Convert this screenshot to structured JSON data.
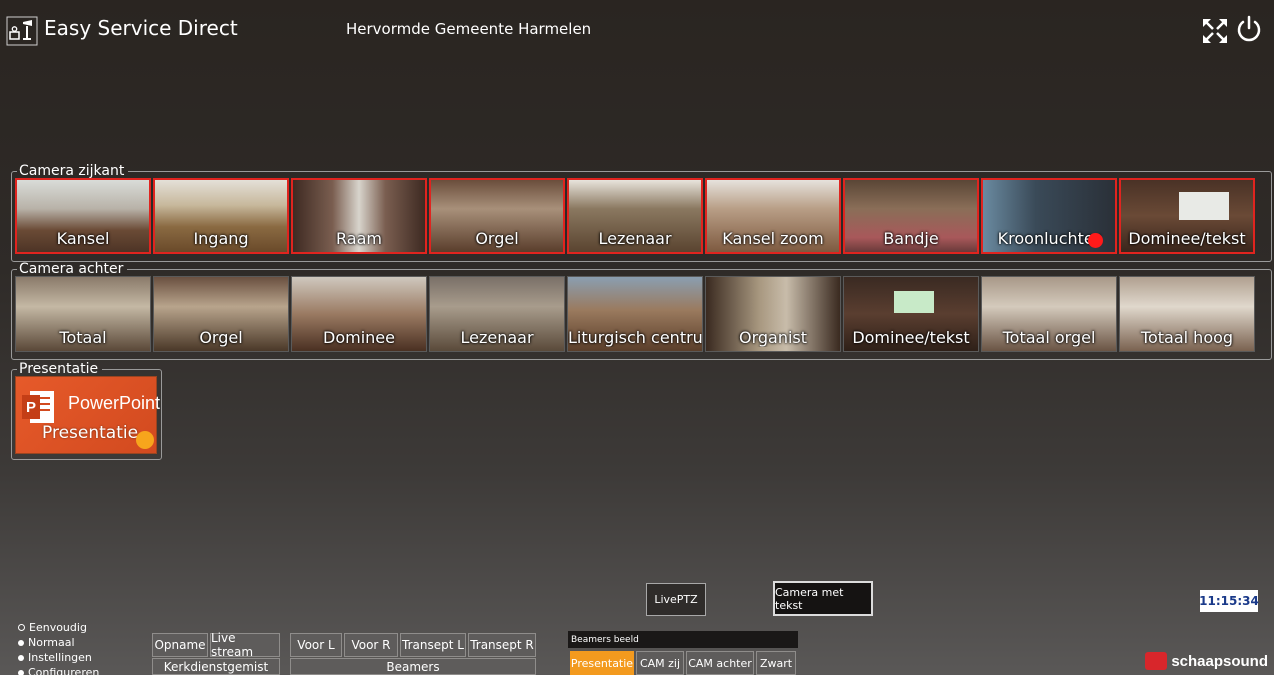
{
  "header": {
    "app_title": "Easy Service Direct",
    "church_name": "Hervormde Gemeente Harmelen"
  },
  "groups": {
    "camera_zijkant": {
      "legend": "Camera zijkant",
      "tiles": [
        {
          "label": "Kansel",
          "dot": false
        },
        {
          "label": "Ingang",
          "dot": false
        },
        {
          "label": "Raam",
          "dot": false
        },
        {
          "label": "Orgel",
          "dot": false
        },
        {
          "label": "Lezenaar",
          "dot": false
        },
        {
          "label": "Kansel zoom",
          "dot": false
        },
        {
          "label": "Bandje",
          "dot": false
        },
        {
          "label": "Kroonluchter",
          "dot": true
        },
        {
          "label": "Dominee/tekst",
          "dot": false
        }
      ]
    },
    "camera_achter": {
      "legend": "Camera achter",
      "tiles": [
        {
          "label": "Totaal"
        },
        {
          "label": "Orgel"
        },
        {
          "label": "Dominee"
        },
        {
          "label": "Lezenaar"
        },
        {
          "label": "Liturgisch centrum"
        },
        {
          "label": "Organist"
        },
        {
          "label": "Dominee/tekst"
        },
        {
          "label": "Totaal orgel"
        },
        {
          "label": "Totaal hoog"
        }
      ]
    },
    "presentatie": {
      "legend": "Presentatie",
      "tile_title": "PowerPoint",
      "tile_label": "Presentatie",
      "dot": true
    }
  },
  "controls": {
    "liveptz": "LivePTZ",
    "camera_met_tekst": "Camera met tekst",
    "clock": "11:15:34"
  },
  "modes": [
    "Eenvoudig",
    "Normaal",
    "Instellingen",
    "Configureren"
  ],
  "recording": {
    "opname": "Opname",
    "live_stream": "Live stream",
    "kerkdienstgemist": "Kerkdienstgemist"
  },
  "beamer_controls": {
    "voor_l": "Voor L",
    "voor_r": "Voor R",
    "transept_l": "Transept L",
    "transept_r": "Transept R",
    "beamers": "Beamers"
  },
  "beamers_beeld": {
    "title": "Beamers beeld",
    "options": [
      "Presentatie",
      "CAM zij",
      "CAM achter",
      "Zwart"
    ]
  },
  "brand": "schaapsound",
  "colors": {
    "active": "#f39a1e",
    "tile_border": "#e0241f",
    "dot_red": "#ff1a1a",
    "dot_orange": "#f7a51c"
  }
}
